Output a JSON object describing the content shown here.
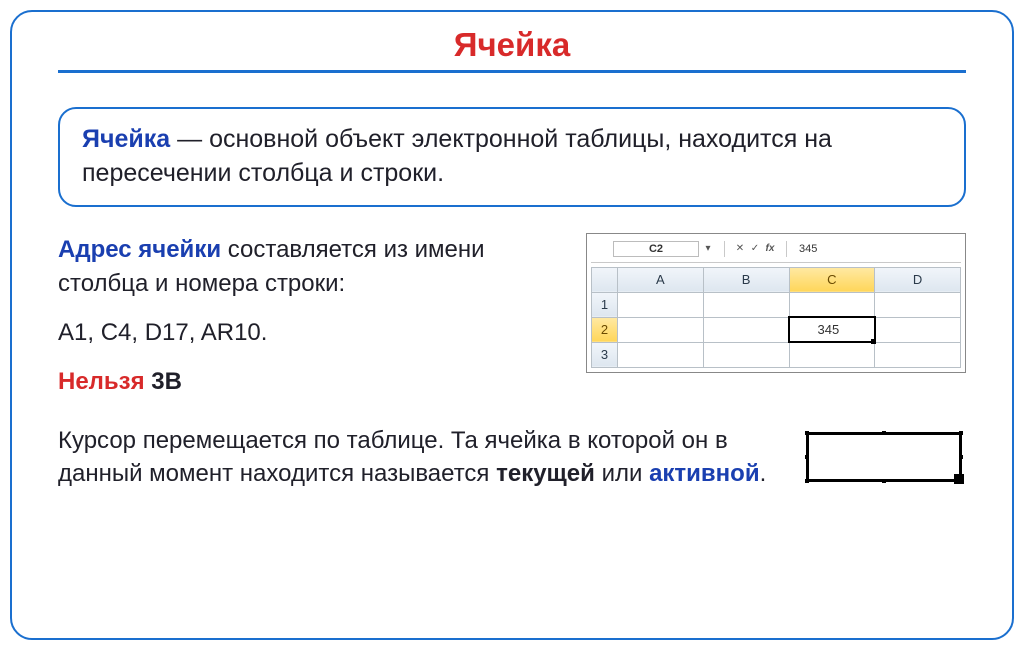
{
  "title": "Ячейка",
  "definition": {
    "term": "Ячейка",
    "text": " — основной объект электронной таблицы, находится на пересечении столбца и строки."
  },
  "address": {
    "term": "Адрес ячейки",
    "text": " составляется из имени столбца и номера строки:",
    "examples": "A1, C4, D17, AR10.",
    "no_label": "Нельзя",
    "bad_example": "3B"
  },
  "mini_sheet": {
    "name_box": "C2",
    "fx_label": "fx",
    "formula_value": "345",
    "buttons": {
      "drop": "▾",
      "cancel": "✕",
      "ok": "✓"
    },
    "cols": [
      "A",
      "B",
      "C",
      "D"
    ],
    "rows": [
      "1",
      "2",
      "3"
    ],
    "active_cell_value": "345"
  },
  "cursor": {
    "text_pre": "Курсор перемещается по таблице. Та ячейка в которой он в данный момент находится называется ",
    "kw1": "текущей",
    "mid": " или ",
    "kw2": "активной",
    "suffix": "."
  }
}
